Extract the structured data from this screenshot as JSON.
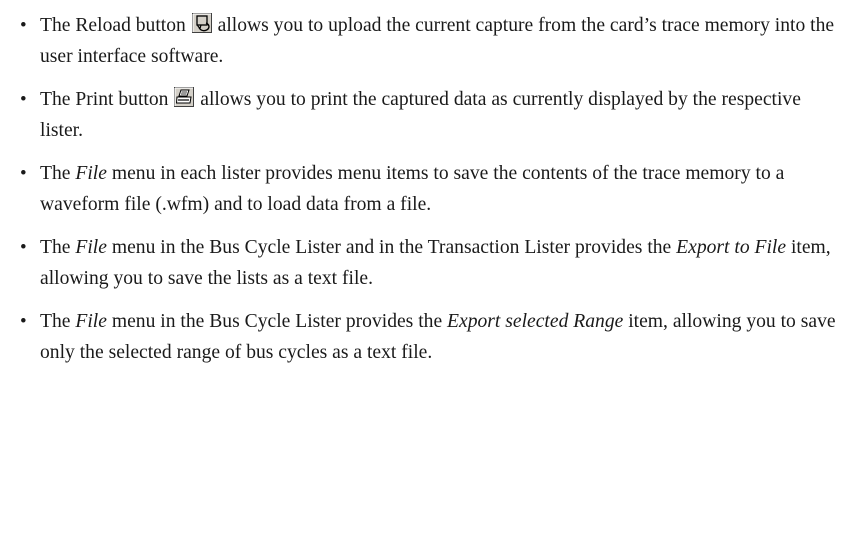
{
  "items": [
    {
      "before": "The Reload button ",
      "icon": "reload-icon",
      "after": " allows you to upload the current capture from the card’s trace memory into the user interface software."
    },
    {
      "before": "The Print button ",
      "icon": "print-icon",
      "after": " allows you to print the captured data as currently displayed by the respective lister."
    },
    {
      "t1": "The ",
      "em1": "File",
      "t2": " menu in each lister provides menu items to save the contents of the trace memory to a waveform file (.wfm) and to load data from a file."
    },
    {
      "t1": "The ",
      "em1": "File",
      "t2": " menu in the Bus Cycle Lister and in the Transaction Lister provides the ",
      "em2": "Export to File",
      "t3": " item, allowing you to save the lists as a text file."
    },
    {
      "t1": "The ",
      "em1": "File",
      "t2": " menu in the Bus Cycle Lister provides the ",
      "em2": "Export selected Range",
      "t3": " item, allowing you to save only the selected range of bus cycles as a text file."
    }
  ],
  "bullet_char": "•"
}
